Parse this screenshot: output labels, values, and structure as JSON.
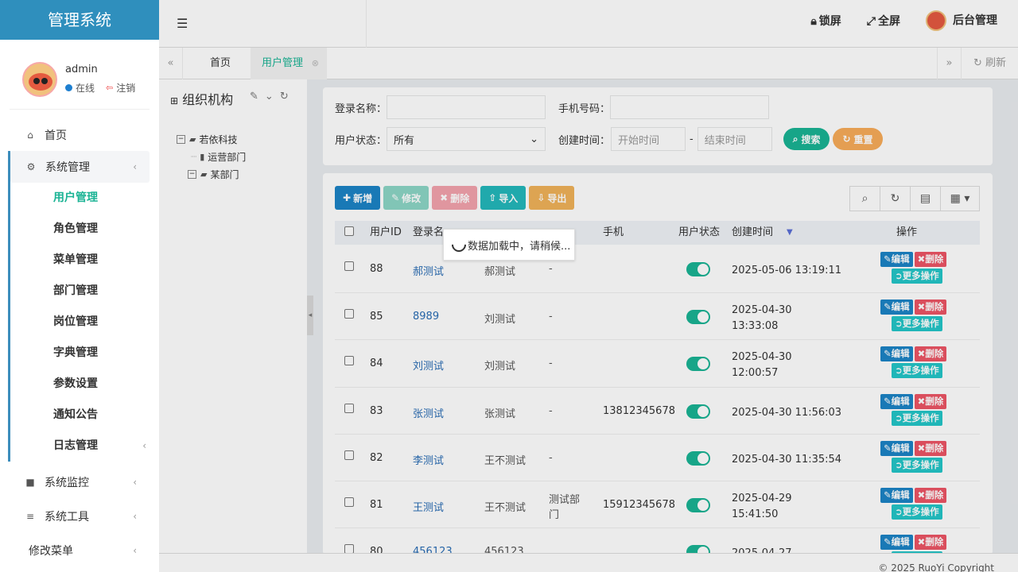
{
  "app": {
    "title": "管理系统"
  },
  "user_panel": {
    "name": "admin",
    "status": "在线",
    "logout": "注销"
  },
  "nav": {
    "home": "首页",
    "system": "系统管理",
    "system_items": [
      "用户管理",
      "角色管理",
      "菜单管理",
      "部门管理",
      "岗位管理",
      "字典管理",
      "参数设置",
      "通知公告",
      "日志管理"
    ],
    "monitor": "系统监控",
    "tools": "系统工具",
    "modify_menu": "修改菜单"
  },
  "topbar": {
    "lock": "锁屏",
    "fullscreen": "全屏",
    "admin": "后台管理"
  },
  "tabs": {
    "home": "首页",
    "active": "用户管理",
    "refresh": "刷新"
  },
  "tree": {
    "title": "组织机构",
    "root": "若依科技",
    "children": [
      "运营部门",
      "某部门"
    ]
  },
  "search": {
    "login_label": "登录名称：",
    "phone_label": "手机号码：",
    "status_label": "用户状态：",
    "status_value": "所有",
    "created_label": "创建时间：",
    "start_placeholder": "开始时间",
    "dash": "-",
    "end_placeholder": "结束时间",
    "search_btn": "搜索",
    "reset_btn": "重置"
  },
  "toolbar": {
    "add": "新增",
    "edit": "修改",
    "delete": "删除",
    "import": "导入",
    "export": "导出"
  },
  "table": {
    "headers": {
      "id": "用户ID",
      "login": "登录名",
      "phone": "手机",
      "status": "用户状态",
      "created": "创建时间",
      "ops": "操作"
    },
    "ops": {
      "edit": "编辑",
      "delete": "删除",
      "more": "更多操作"
    },
    "rows": [
      {
        "id": "88",
        "login": "郝测试",
        "name": "郝测试",
        "dept": "-",
        "phone": "",
        "created": "2025-05-06 13:19:11"
      },
      {
        "id": "85",
        "login": "8989",
        "name": "刘测试",
        "dept": "-",
        "phone": "",
        "created": "2025-04-30 13:33:08"
      },
      {
        "id": "84",
        "login": "刘测试",
        "name": "刘测试",
        "dept": "-",
        "phone": "",
        "created": "2025-04-30 12:00:57"
      },
      {
        "id": "83",
        "login": "张测试",
        "name": "张测试",
        "dept": "-",
        "phone": "13812345678",
        "created": "2025-04-30 11:56:03"
      },
      {
        "id": "82",
        "login": "李测试",
        "name": "王不测试",
        "dept": "-",
        "phone": "",
        "created": "2025-04-30 11:35:54"
      },
      {
        "id": "81",
        "login": "王测试",
        "name": "王不测试",
        "dept": "测试部门",
        "phone": "15912345678",
        "created": "2025-04-29 15:41:50"
      },
      {
        "id": "80",
        "login": "456123",
        "name": "456123",
        "dept": "",
        "phone": "",
        "created": "2025-04-27"
      }
    ]
  },
  "loading": "数据加载中，请稍候...",
  "footer": "© 2025 RuoYi Copyright"
}
